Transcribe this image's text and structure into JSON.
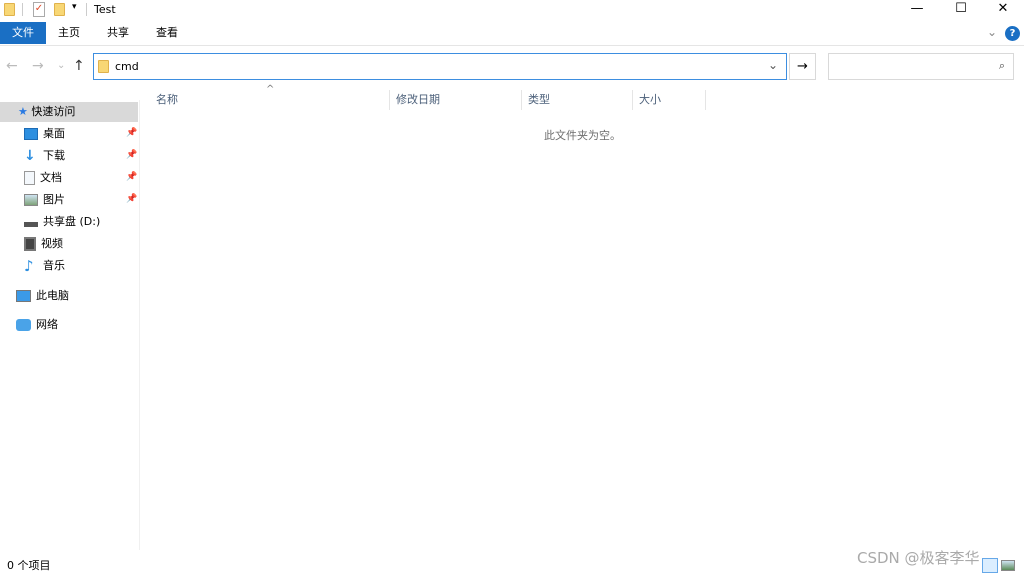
{
  "window": {
    "title": "Test",
    "minimize": "—",
    "maximize": "☐",
    "close": "✕"
  },
  "ribbon": {
    "tabs": [
      "文件",
      "主页",
      "共享",
      "查看"
    ],
    "help": "?",
    "expand": "⌄"
  },
  "nav": {
    "back": "←",
    "forward": "→",
    "recent": "⌄",
    "up": "↑",
    "go": "→"
  },
  "address": {
    "value": "cmd",
    "dropdown": "⌄"
  },
  "search": {
    "placeholder": "",
    "icon": "search-icon"
  },
  "sidebar": {
    "quick_access": "快速访问",
    "items": [
      {
        "label": "桌面",
        "icon": "desktop-icon",
        "pinned": true
      },
      {
        "label": "下载",
        "icon": "download-icon",
        "pinned": true
      },
      {
        "label": "文档",
        "icon": "documents-icon",
        "pinned": true
      },
      {
        "label": "图片",
        "icon": "pictures-icon",
        "pinned": true
      },
      {
        "label": "共享盘 (D:)",
        "icon": "drive-icon",
        "pinned": false
      },
      {
        "label": "视频",
        "icon": "videos-icon",
        "pinned": false
      },
      {
        "label": "音乐",
        "icon": "music-icon",
        "pinned": false
      }
    ],
    "this_pc": "此电脑",
    "network": "网络"
  },
  "columns": [
    "名称",
    "修改日期",
    "类型",
    "大小"
  ],
  "empty_message": "此文件夹为空。",
  "status": {
    "count": "0 个项目"
  },
  "watermark": "CSDN @极客李华",
  "colors": {
    "accent": "#1a6fc4",
    "selected": "#d9d9d9"
  }
}
